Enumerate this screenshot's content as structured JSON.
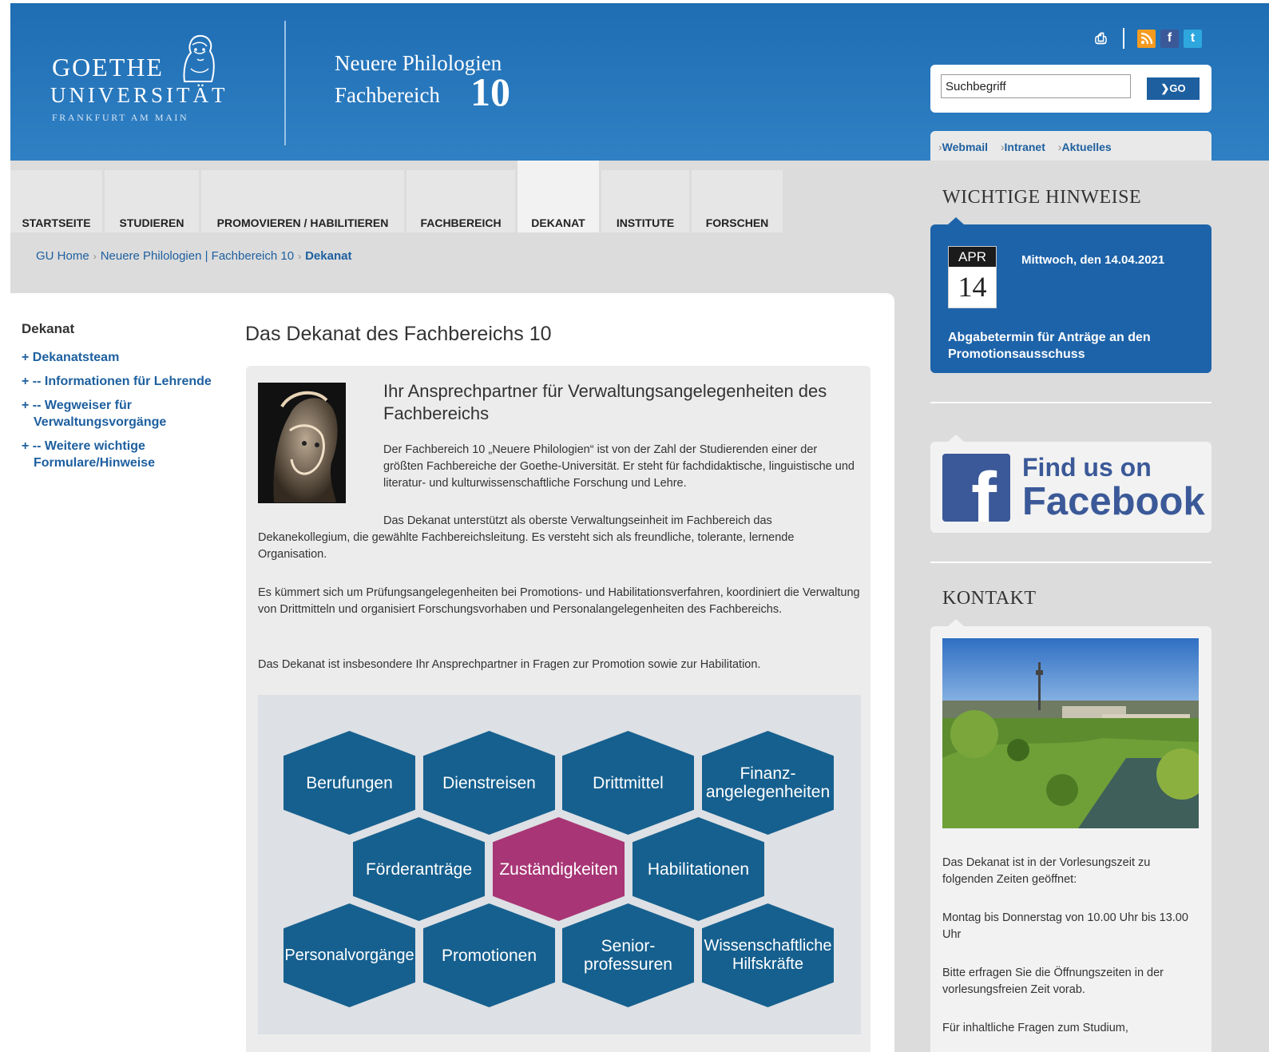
{
  "colors": {
    "brand": "#1d5f9f",
    "header": "#2f80c4",
    "accent_hex": "#a83575",
    "hex": "#16608f"
  },
  "logo": {
    "line1": "GOETHE",
    "line2": "UNIVERSITÄT",
    "line3": "FRANKFURT AM MAIN"
  },
  "faculty": {
    "line1": "Neuere Philologien",
    "line2": "Fachbereich",
    "number": "10"
  },
  "tools": {
    "icons": [
      "print-icon",
      "rss-icon",
      "facebook-icon",
      "twitter-icon"
    ]
  },
  "search": {
    "value": "Suchbegriff",
    "button": "GO"
  },
  "quicklinks": [
    "Webmail",
    "Intranet",
    "Aktuelles"
  ],
  "nav": {
    "tabs": [
      "STARTSEITE",
      "STUDIEREN",
      "PROMOVIEREN / HABILITIEREN",
      "FACHBEREICH",
      "DEKANAT",
      "INSTITUTE",
      "FORSCHEN"
    ],
    "active": "DEKANAT"
  },
  "breadcrumb": [
    "GU Home",
    "Neuere Philologien | Fachbereich 10",
    "Dekanat"
  ],
  "leftnav": {
    "title": "Dekanat",
    "items": [
      "Dekanatsteam",
      "-- Informationen für Lehrende",
      "-- Wegweiser für Verwaltungsvorgänge",
      "-- Weitere wichtige Formulare/Hinweise"
    ]
  },
  "main": {
    "title": "Das Dekanat des Fachbereichs 10",
    "subtitle": "Ihr Ansprechpartner für Verwaltungsangelegenheiten des Fachbereichs",
    "p1": "Der Fachbereich 10 „Neuere Philologien“ ist von der Zahl der Studierenden einer der größten Fachbereiche der Goethe-Universität. Er steht für fachdidaktische, linguistische und literatur- und kulturwissenschaftliche Forschung und Lehre.",
    "p2a": "Das Dekanat unterstützt als oberste Verwaltungseinheit im Fachbereich das",
    "p2b": "Dekanekollegium, die gewählte Fachbereichsleitung. Es versteht sich als freundliche, tolerante, lernende Organisation.",
    "p3": "Es kümmert sich um Prüfungsangelegenheiten bei Promotions- und Habilitationsverfahren, koordiniert die Verwaltung von Drittmitteln und organisiert Forschungsvorhaben und Personalangelegenheiten des Fachbereichs.",
    "p4": "Das Dekanat ist insbesondere Ihr Ansprechpartner in Fragen zur Promotion sowie zur Habilitation.",
    "hexagons": [
      "Berufungen",
      "Dienstreisen",
      "Drittmittel",
      "Finanz-\nangelegenheiten",
      "Förderanträge",
      "Zuständigkeiten",
      "Habilitationen",
      "Personalvorgänge",
      "Promotionen",
      "Senior-\nprofessuren",
      "Wissenschaftliche\nHilfskräfte"
    ]
  },
  "sidebar": {
    "hinweise_title": "WICHTIGE HINWEISE",
    "event": {
      "month": "APR",
      "day": "14",
      "date": "Mittwoch, den 14.04.2021",
      "text": "Abgabetermin für Anträge an den Promotionsausschuss"
    },
    "facebook": {
      "line1": "Find us on",
      "line2": "Facebook"
    },
    "kontakt_title": "KONTAKT",
    "kontakt": {
      "t1": "Das Dekanat ist in der Vorlesungszeit zu folgenden Zeiten geöffnet:",
      "t2": "Montag bis Donnerstag von 10.00 Uhr bis 13.00 Uhr",
      "t3": "Bitte erfragen Sie die Öffnungszeiten in der vorlesungsfreien Zeit vorab.",
      "t4": "Für inhaltliche Fragen zum Studium,"
    }
  }
}
